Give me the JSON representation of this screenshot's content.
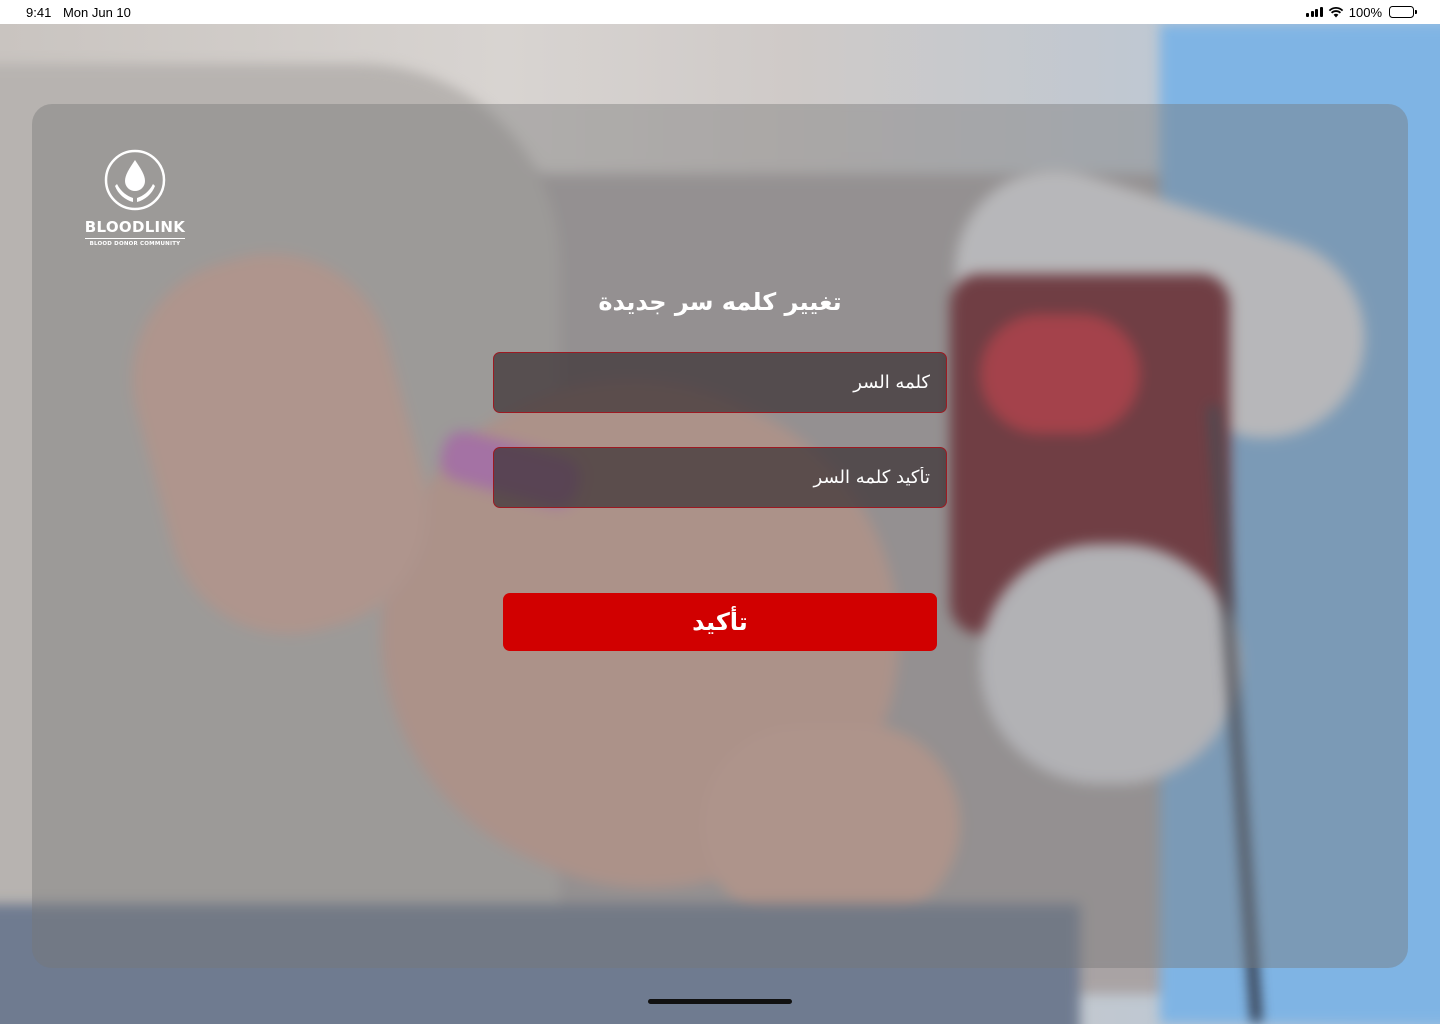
{
  "status_bar": {
    "time": "9:41",
    "date": "Mon Jun 10",
    "battery": "100%"
  },
  "logo": {
    "name": "BLOODLINK",
    "tagline": "BLOOD DONOR COMMUNITY"
  },
  "form": {
    "title": "تغيير كلمه سر جديدة",
    "password_placeholder": "كلمه السر",
    "confirm_password_placeholder": "تأكيد كلمه السر",
    "submit_label": "تأكيد"
  },
  "colors": {
    "accent": "#d10000",
    "field_border": "#9c1a22"
  }
}
